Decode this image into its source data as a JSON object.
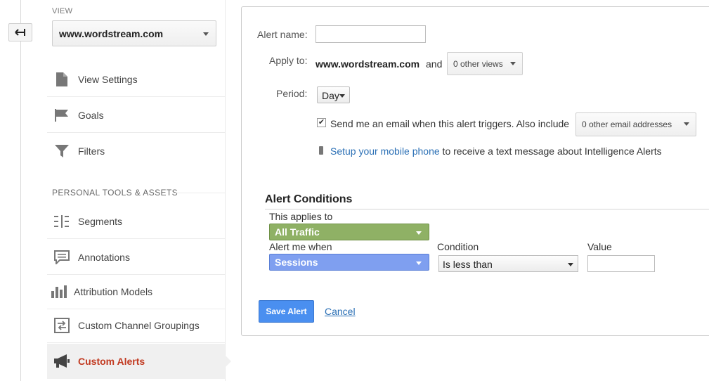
{
  "sidebar": {
    "view_label": "VIEW",
    "view_value": "www.wordstream.com",
    "items_top": [
      {
        "label": "View Settings",
        "icon": "document-icon"
      },
      {
        "label": "Goals",
        "icon": "flag-icon"
      },
      {
        "label": "Filters",
        "icon": "funnel-icon"
      }
    ],
    "section_label": "PERSONAL TOOLS & ASSETS",
    "items_bottom": [
      {
        "label": "Segments",
        "icon": "segments-icon"
      },
      {
        "label": "Annotations",
        "icon": "comment-icon"
      },
      {
        "label": "Attribution Models",
        "icon": "bar-chart-icon"
      },
      {
        "label": "Custom Channel Groupings",
        "icon": "channel-groupings-icon"
      },
      {
        "label": "Custom Alerts",
        "icon": "megaphone-icon",
        "active": true
      }
    ]
  },
  "form": {
    "alert_name_label": "Alert name:",
    "alert_name_value": "",
    "apply_to_label": "Apply to:",
    "apply_to_view": "www.wordstream.com",
    "and_text": "and",
    "other_views": "0 other views",
    "period_label": "Period:",
    "period_value": "Day",
    "email_checked": true,
    "email_text": "Send me an email when this alert triggers. Also include",
    "other_emails": "0 other email addresses",
    "mobile_link": "Setup your mobile phone",
    "mobile_text": " to receive a text message about Intelligence Alerts"
  },
  "conditions": {
    "title": "Alert Conditions",
    "applies_label": "This applies to",
    "applies_value": "All Traffic",
    "alert_when_label": "Alert me when",
    "alert_when_value": "Sessions",
    "condition_label": "Condition",
    "condition_value": "Is less than",
    "value_label": "Value",
    "value_value": ""
  },
  "actions": {
    "save_label": "Save Alert",
    "cancel_label": "Cancel"
  },
  "colors": {
    "accent_active": "#c23b22",
    "traffic_green": "#8fb165",
    "sessions_blue": "#7f9ff0",
    "save_blue": "#4a8ff0",
    "link_blue": "#2a6fb5"
  }
}
